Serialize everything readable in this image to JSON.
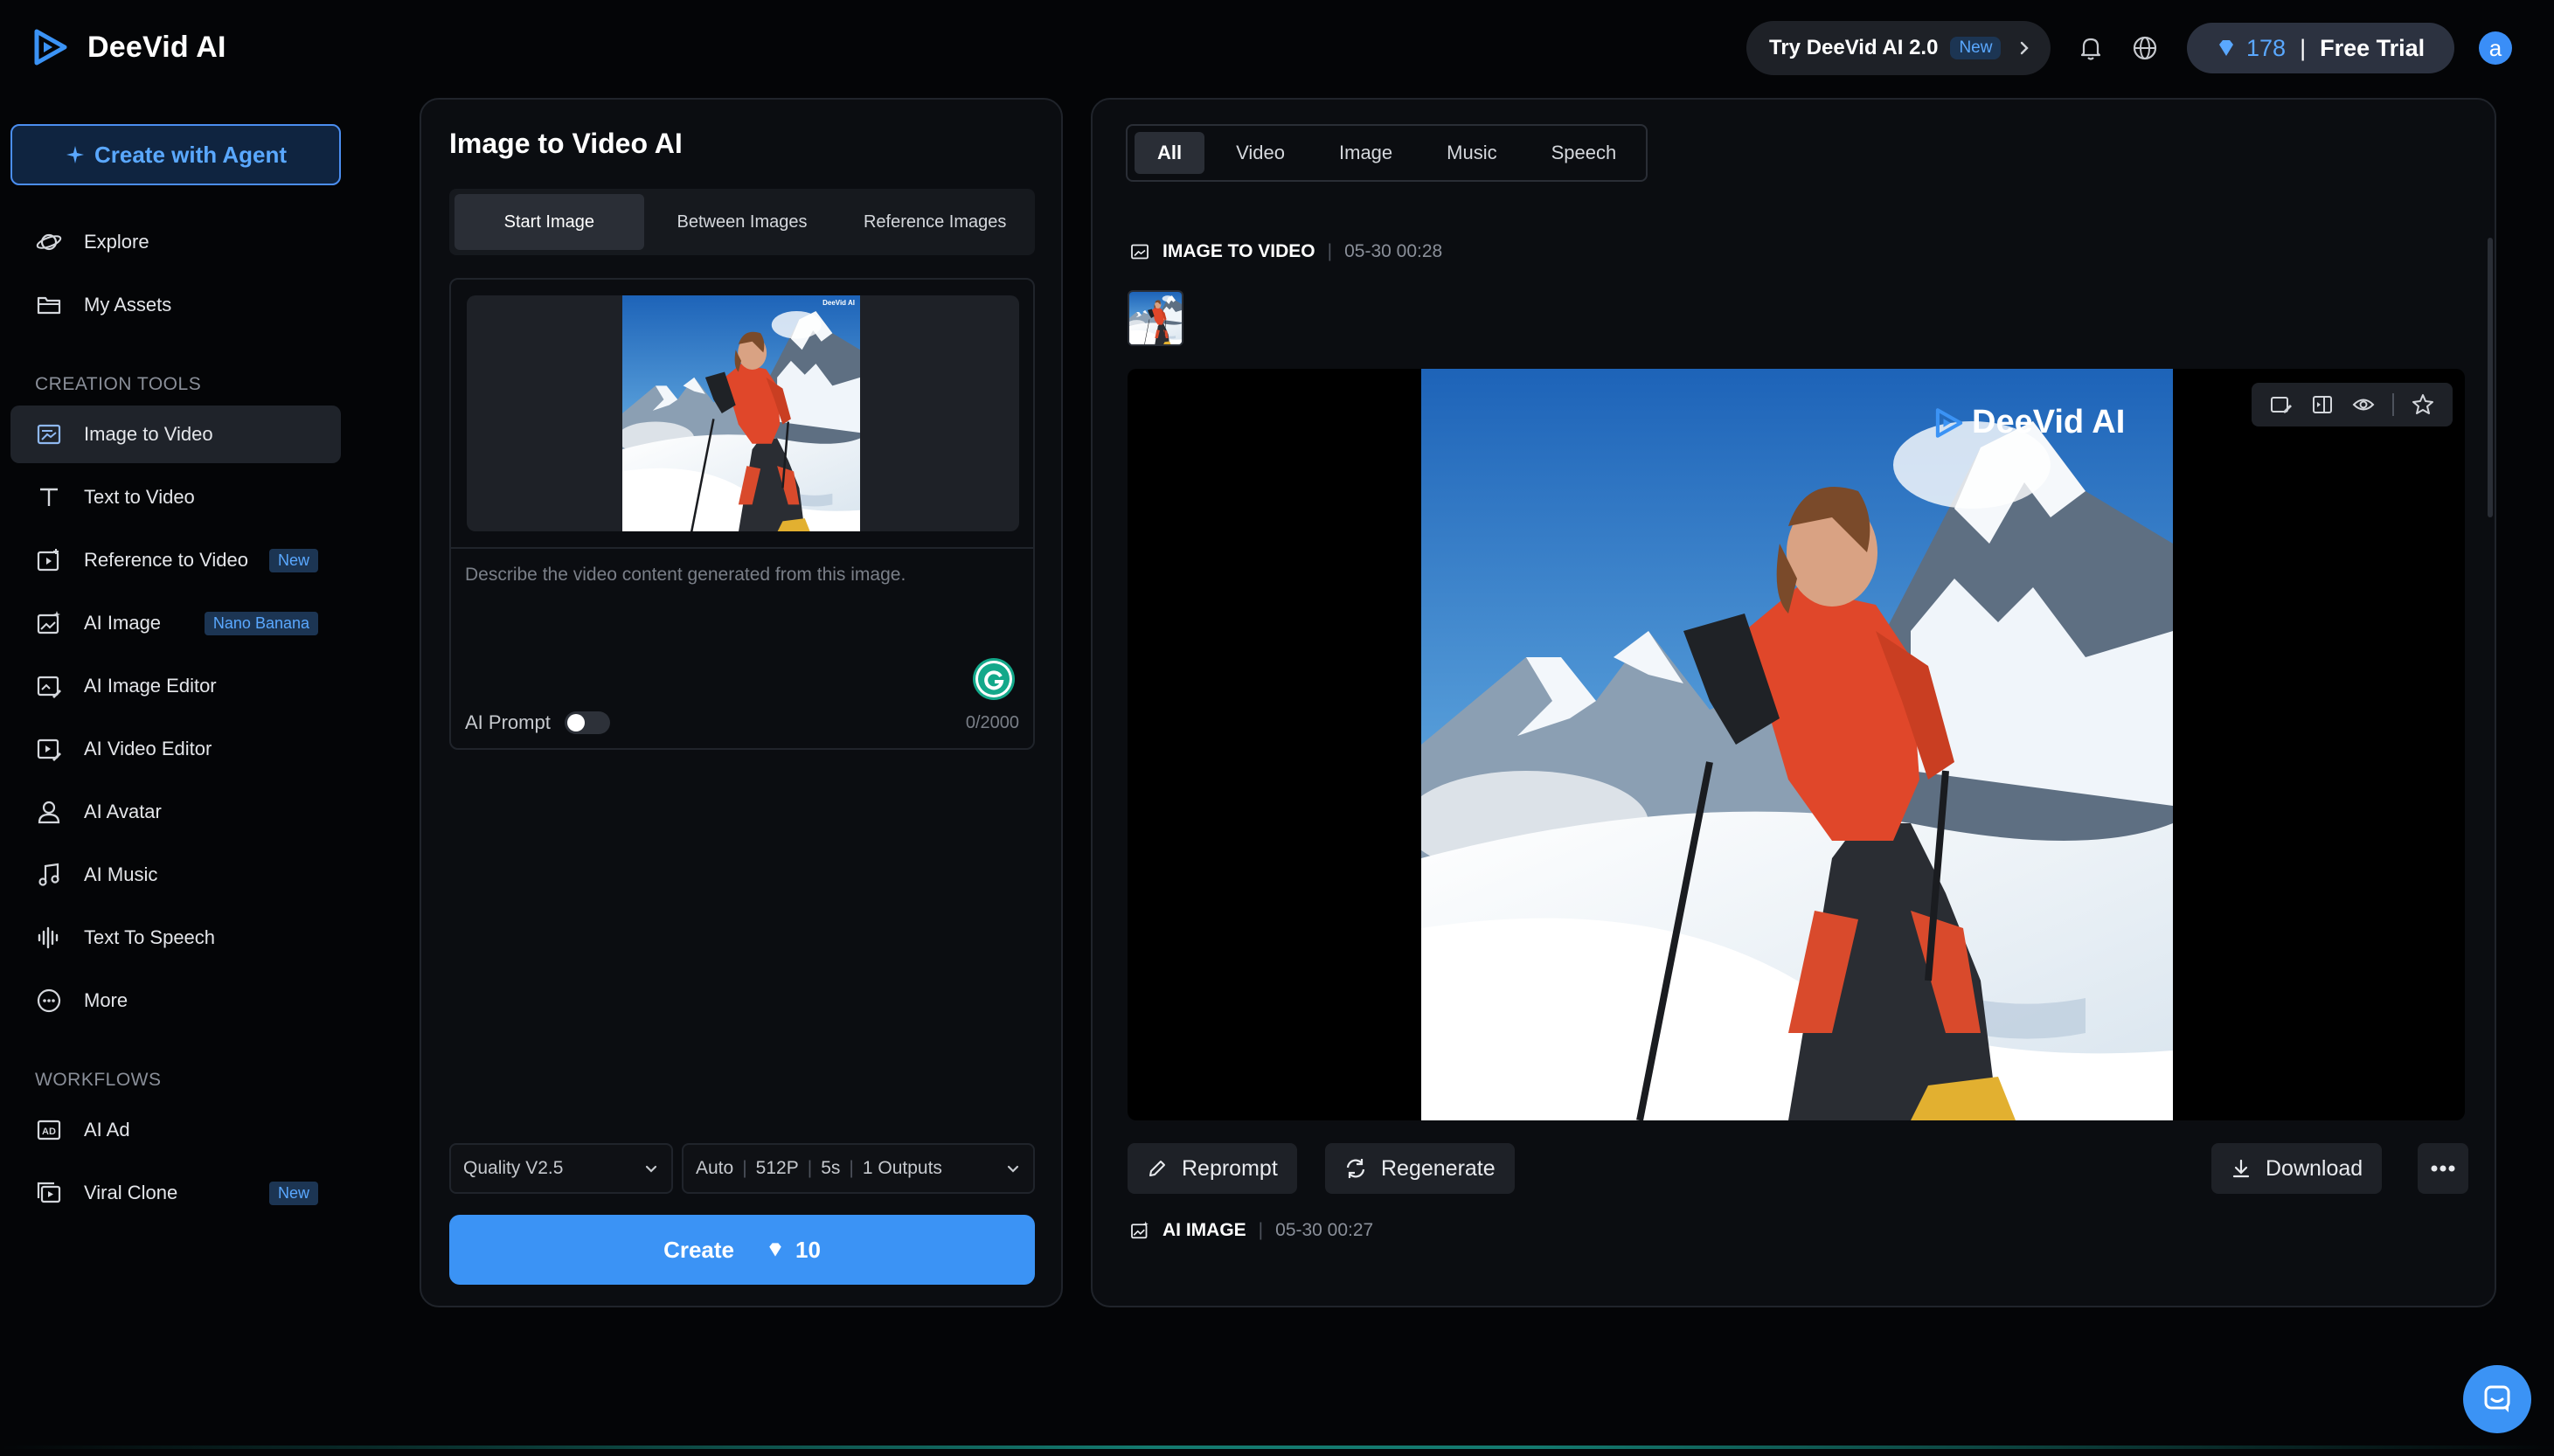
{
  "header": {
    "brand": "DeeVid AI",
    "try_label": "Try DeeVid AI 2.0",
    "try_badge": "New",
    "credits": "178",
    "plan": "Free Trial",
    "avatar_letter": "a"
  },
  "sidebar": {
    "agent_button": "Create with Agent",
    "items": [
      {
        "label": "Explore"
      },
      {
        "label": "My Assets"
      }
    ],
    "creation_title": "CREATION TOOLS",
    "tools": [
      {
        "label": "Image to Video"
      },
      {
        "label": "Text to Video"
      },
      {
        "label": "Reference to Video",
        "tag": "New"
      },
      {
        "label": "AI Image",
        "tag": "Nano Banana"
      },
      {
        "label": "AI Image Editor"
      },
      {
        "label": "AI Video Editor"
      },
      {
        "label": "AI Avatar"
      },
      {
        "label": "AI Music"
      },
      {
        "label": "Text To Speech"
      },
      {
        "label": "More"
      }
    ],
    "workflows_title": "WORKFLOWS",
    "workflows": [
      {
        "label": "AI Ad"
      },
      {
        "label": "Viral Clone",
        "tag": "New"
      }
    ]
  },
  "left_panel": {
    "title": "Image to Video AI",
    "tabs": [
      "Start Image",
      "Between Images",
      "Reference Images"
    ],
    "thumb_watermark": "DeeVid AI",
    "prompt_placeholder": "Describe the video content generated from this image.",
    "ai_prompt_label": "AI Prompt",
    "counter": "0/2000",
    "quality": "Quality V2.5",
    "settings": {
      "ratio": "Auto",
      "resolution": "512P",
      "duration": "5s",
      "outputs": "1 Outputs"
    },
    "create_label": "Create",
    "create_cost": "10"
  },
  "right_panel": {
    "filters": [
      "All",
      "Video",
      "Image",
      "Music",
      "Speech"
    ],
    "record1": {
      "type": "IMAGE TO VIDEO",
      "time": "05-30 00:28"
    },
    "watermark": "DeeVid AI",
    "actions": {
      "reprompt": "Reprompt",
      "regenerate": "Regenerate",
      "download": "Download"
    },
    "record2": {
      "type": "AI IMAGE",
      "time": "05-30 00:27"
    }
  },
  "colors": {
    "accent": "#3b93f5",
    "badge_text": "#5aa8ff",
    "panel_bg": "#0b0d11"
  }
}
